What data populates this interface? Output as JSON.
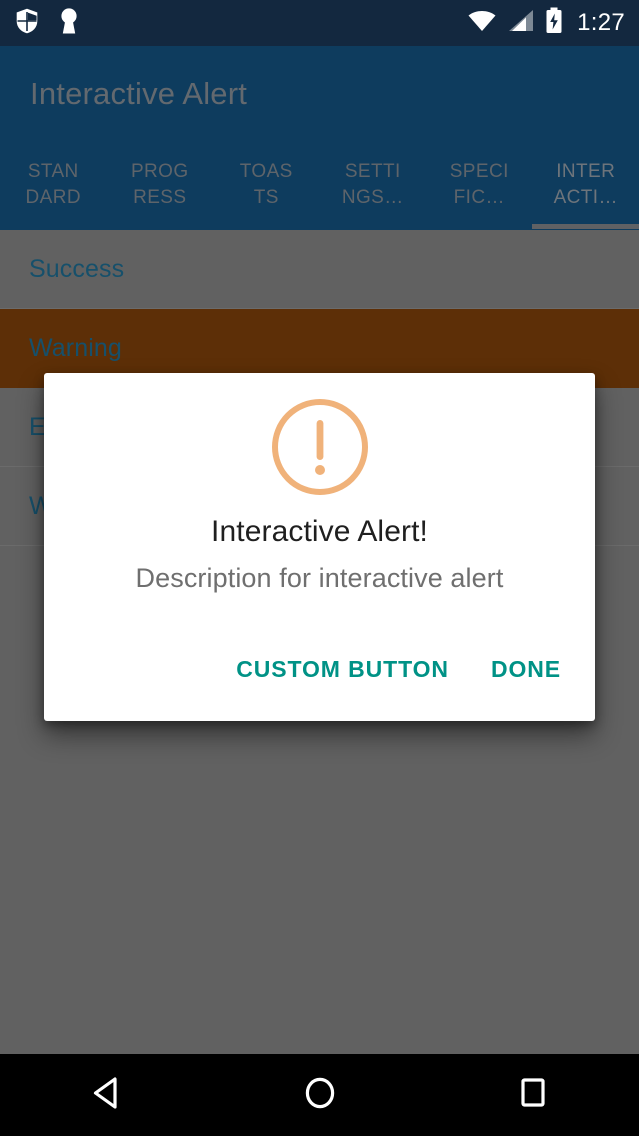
{
  "status_bar": {
    "icons": [
      "shield-icon",
      "keyhole-icon",
      "wifi-icon",
      "cellular-signal-icon",
      "battery-charging-icon"
    ],
    "clock": "1:27",
    "background_color": "#13283F",
    "foreground_color": "#FFFFFF"
  },
  "app_bar": {
    "title": "Interactive Alert",
    "background_color": "#0E3C5E",
    "title_color": "#63696F"
  },
  "tabs": {
    "selected_index": 5,
    "indicator_color": "#5F6164",
    "items": [
      {
        "line1": "STAN",
        "line2": "DARD",
        "full": "STANDARD"
      },
      {
        "line1": "PROG",
        "line2": "RESS",
        "full": "PROGRESS"
      },
      {
        "line1": "TOAS",
        "line2": "TS",
        "full": "TOASTS"
      },
      {
        "line1": "SETTI",
        "line2": "NGS…",
        "full": "SETTINGS…"
      },
      {
        "line1": "SPECI",
        "line2": "FIC…",
        "full": "SPECIFIC…"
      },
      {
        "line1": "INTER",
        "line2": "ACTI…",
        "full": "INTERACTI…"
      }
    ]
  },
  "list": {
    "scrim_color": "#616161",
    "item_text_color": "#16506B",
    "highlight_color": "#5D2F07",
    "items": [
      {
        "label": "Success",
        "highlighted": false
      },
      {
        "label": "Warning",
        "highlighted": true
      },
      {
        "label": "Error",
        "highlighted": false
      },
      {
        "label": "Wait",
        "highlighted": false
      }
    ]
  },
  "dialog": {
    "icon": "exclamation-circle-icon",
    "icon_color": "#F0B27A",
    "title": "Interactive Alert!",
    "message": "Description for interactive alert",
    "buttons": [
      {
        "label": "CUSTOM BUTTON",
        "name": "custom-button"
      },
      {
        "label": "DONE",
        "name": "done-button"
      }
    ],
    "button_color": "#009286",
    "background_color": "#FFFFFF"
  },
  "nav_bar": {
    "background_color": "#000000",
    "buttons": [
      {
        "name": "back-button",
        "icon": "back-triangle-icon"
      },
      {
        "name": "home-button",
        "icon": "home-circle-icon"
      },
      {
        "name": "recents-button",
        "icon": "recents-square-icon"
      }
    ]
  }
}
